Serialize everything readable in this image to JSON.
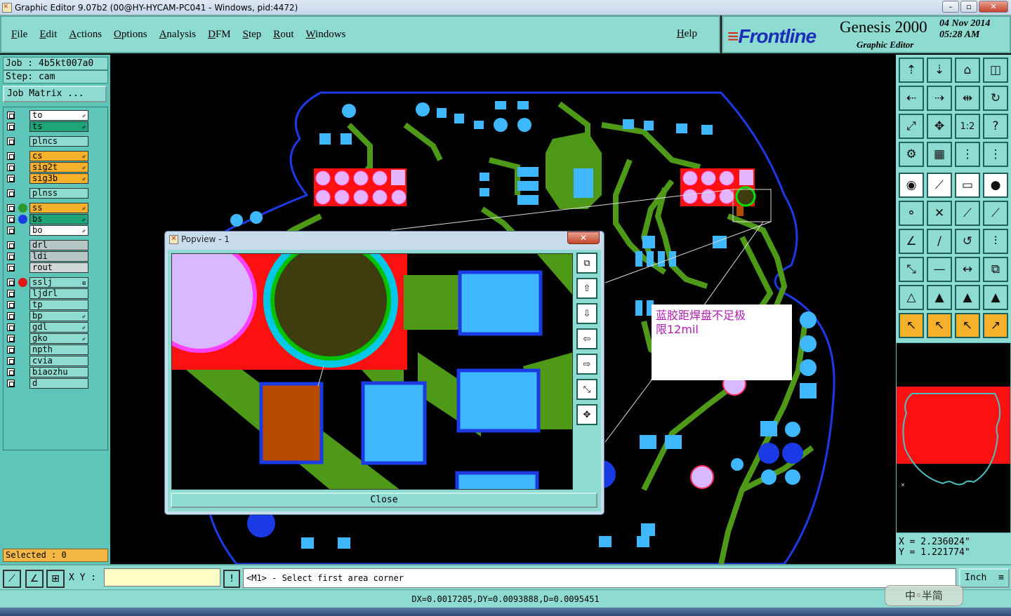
{
  "window": {
    "title": "Graphic Editor 9.07b2 (00@HY-HYCAM-PC041 - Windows, pid:4472)",
    "buttons": [
      "–",
      "▫",
      "✕"
    ]
  },
  "menu": {
    "items": [
      "File",
      "Edit",
      "Actions",
      "Options",
      "Analysis",
      "DFM",
      "Step",
      "Rout",
      "Windows"
    ],
    "help": "Help"
  },
  "brand": {
    "logo": "Frontline",
    "product": "Genesis 2000",
    "subtitle": "Graphic Editor",
    "date": "04 Nov 2014",
    "time": "05:28 AM"
  },
  "job": {
    "job": "Job : 4b5kt007a0",
    "step": "Step: cam",
    "matrix_button": "Job Matrix ..."
  },
  "layers": [
    {
      "name": "to",
      "bg": "#ffffff",
      "dot": "",
      "mark": "✐"
    },
    {
      "name": "ts",
      "bg": "#1fa57a",
      "dot": "",
      "mark": "✐"
    },
    {
      "name": "plncs",
      "bg": "#8edbd2",
      "dot": "",
      "mark": ""
    },
    {
      "name": "cs",
      "bg": "#f5b02c",
      "dot": "",
      "mark": "✐"
    },
    {
      "name": "sig2t",
      "bg": "#f5b02c",
      "dot": "",
      "mark": "✐"
    },
    {
      "name": "sig3b",
      "bg": "#f5b02c",
      "dot": "",
      "mark": "✐"
    },
    {
      "name": "plnss",
      "bg": "#8edbd2",
      "dot": "",
      "mark": ""
    },
    {
      "name": "ss",
      "bg": "#f5b02c",
      "dot": "#2d9a2d",
      "mark": "✐"
    },
    {
      "name": "bs",
      "bg": "#1fa57a",
      "dot": "#1a3ae6",
      "mark": "✐"
    },
    {
      "name": "bo",
      "bg": "#ffffff",
      "dot": "",
      "mark": "✐"
    },
    {
      "name": "drl",
      "bg": "#b6c8c6",
      "dot": "",
      "mark": ""
    },
    {
      "name": "ldi",
      "bg": "#b6c8c6",
      "dot": "",
      "mark": ""
    },
    {
      "name": "rout",
      "bg": "#d0d8d8",
      "dot": "",
      "mark": ""
    },
    {
      "name": "sslj",
      "bg": "#8edbd2",
      "dot": "#e01818",
      "mark": "⊞"
    },
    {
      "name": "ljdrl",
      "bg": "#8edbd2",
      "dot": "",
      "mark": ""
    },
    {
      "name": "tp",
      "bg": "#8edbd2",
      "dot": "",
      "mark": ""
    },
    {
      "name": "bp",
      "bg": "#8edbd2",
      "dot": "",
      "mark": "✐"
    },
    {
      "name": "gdl",
      "bg": "#8edbd2",
      "dot": "",
      "mark": "✐"
    },
    {
      "name": "gko",
      "bg": "#8edbd2",
      "dot": "",
      "mark": "✐"
    },
    {
      "name": "npth",
      "bg": "#8edbd2",
      "dot": "",
      "mark": ""
    },
    {
      "name": "cvia",
      "bg": "#8edbd2",
      "dot": "",
      "mark": ""
    },
    {
      "name": "biaozhu",
      "bg": "#8edbd2",
      "dot": "",
      "mark": ""
    },
    {
      "name": "d",
      "bg": "#8edbd2",
      "dot": "",
      "mark": ""
    }
  ],
  "selected": "Selected : 0",
  "coords": {
    "x": "X = 2.236024\"",
    "y": "Y = 1.221774\""
  },
  "bottom": {
    "xy_label": "X Y :",
    "xy_value": "",
    "warn": "!",
    "message": "<M1> - Select first area corner",
    "unit": "Inch",
    "unit_icon": "≡"
  },
  "status": "DX=0.0017205,DY=0.0093888,D=0.0095451",
  "ime": "中◦半简",
  "popview": {
    "title": "Popview - 1",
    "close_x": "✕",
    "close_button": "Close"
  },
  "annotation": {
    "line1": "蓝胶距焊盘不足极",
    "line2": "限12mil"
  },
  "colors": {
    "accent": "#8edbd2",
    "signal": "#4e9a18",
    "pad": "#40b8ff",
    "board_outline": "#1e3ae8",
    "solder_mask": "#ff0000",
    "selected_bg": "#f5b844"
  }
}
